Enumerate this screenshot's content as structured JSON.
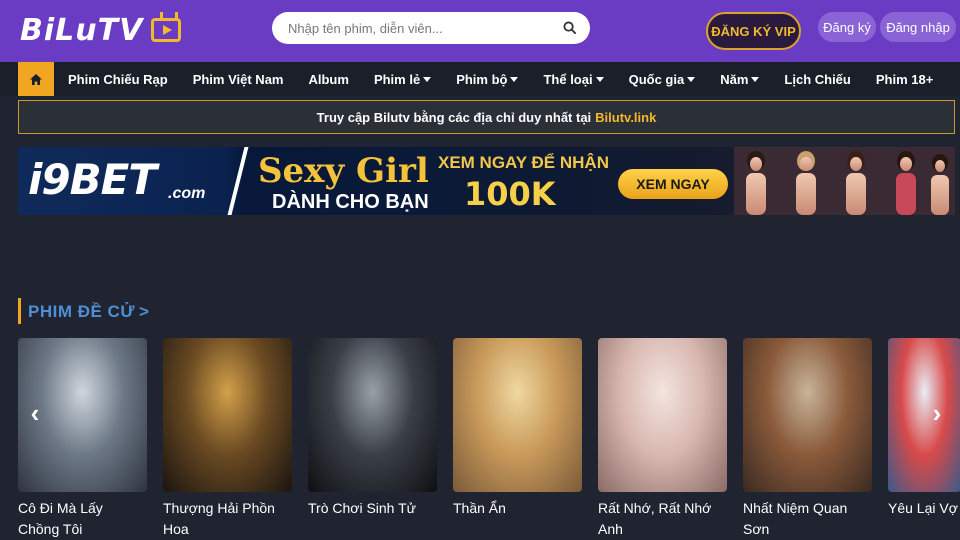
{
  "header": {
    "logo_text": "BiLuTV",
    "search_placeholder": "Nhập tên phim, diễn viên...",
    "vip_label": "ĐĂNG KÝ VIP",
    "register_label": "Đăng ký",
    "login_label": "Đăng nhập"
  },
  "nav": {
    "items": [
      {
        "label": "Phim Chiếu Rạp",
        "dropdown": false
      },
      {
        "label": "Phim Việt Nam",
        "dropdown": false
      },
      {
        "label": "Album",
        "dropdown": false
      },
      {
        "label": "Phim lẻ",
        "dropdown": true
      },
      {
        "label": "Phim bộ",
        "dropdown": true
      },
      {
        "label": "Thể loại",
        "dropdown": true
      },
      {
        "label": "Quốc gia",
        "dropdown": true
      },
      {
        "label": "Năm",
        "dropdown": true
      },
      {
        "label": "Lịch Chiếu",
        "dropdown": false
      },
      {
        "label": "Phim 18+",
        "dropdown": false
      }
    ]
  },
  "notice": {
    "text": "Truy cập Bilutv bằng các địa chỉ duy nhất tại",
    "link": "Bilutv.link"
  },
  "banner": {
    "brand": "i9BET",
    "brand_suffix": ".com",
    "headline": "Sexy Girl",
    "subline": "DÀNH CHO BẠN",
    "cta_text": "XEM NGAY ĐỂ NHẬN",
    "amount": "100K",
    "button": "XEM NGAY"
  },
  "section": {
    "title": "PHIM ĐỀ CỬ",
    "chevron": ">"
  },
  "movies": [
    {
      "title": "Cô Đi Mà Lấy Chồng Tôi",
      "colors": [
        "#cfd6de",
        "#6d7886",
        "#2e3440"
      ]
    },
    {
      "title": "Thượng Hải Phồn Hoa",
      "colors": [
        "#d3a04a",
        "#6a4a22",
        "#1a1410"
      ]
    },
    {
      "title": "Trò Chơi Sinh Tử",
      "colors": [
        "#9aa0a8",
        "#3a3f47",
        "#0e0f12"
      ]
    },
    {
      "title": "Thần Ẩn",
      "colors": [
        "#f0d8a0",
        "#c99a5a",
        "#7a5a3a"
      ]
    },
    {
      "title": "Rất Nhớ, Rất Nhớ Anh",
      "colors": [
        "#f4e4e0",
        "#d8b8b0",
        "#8a6a66"
      ]
    },
    {
      "title": "Nhất Niệm Quan Sơn",
      "colors": [
        "#c8b49a",
        "#8a5a3a",
        "#3a2a22"
      ]
    },
    {
      "title": "Yêu Lại Vợ Cũ",
      "colors": [
        "#e8eef6",
        "#d84a4a",
        "#3a5a8a"
      ]
    }
  ],
  "colors": {
    "header_bg": "#6a3cc3",
    "accent": "#f2a622",
    "page_bg": "#1f2430",
    "section_title": "#4f8fd6"
  }
}
